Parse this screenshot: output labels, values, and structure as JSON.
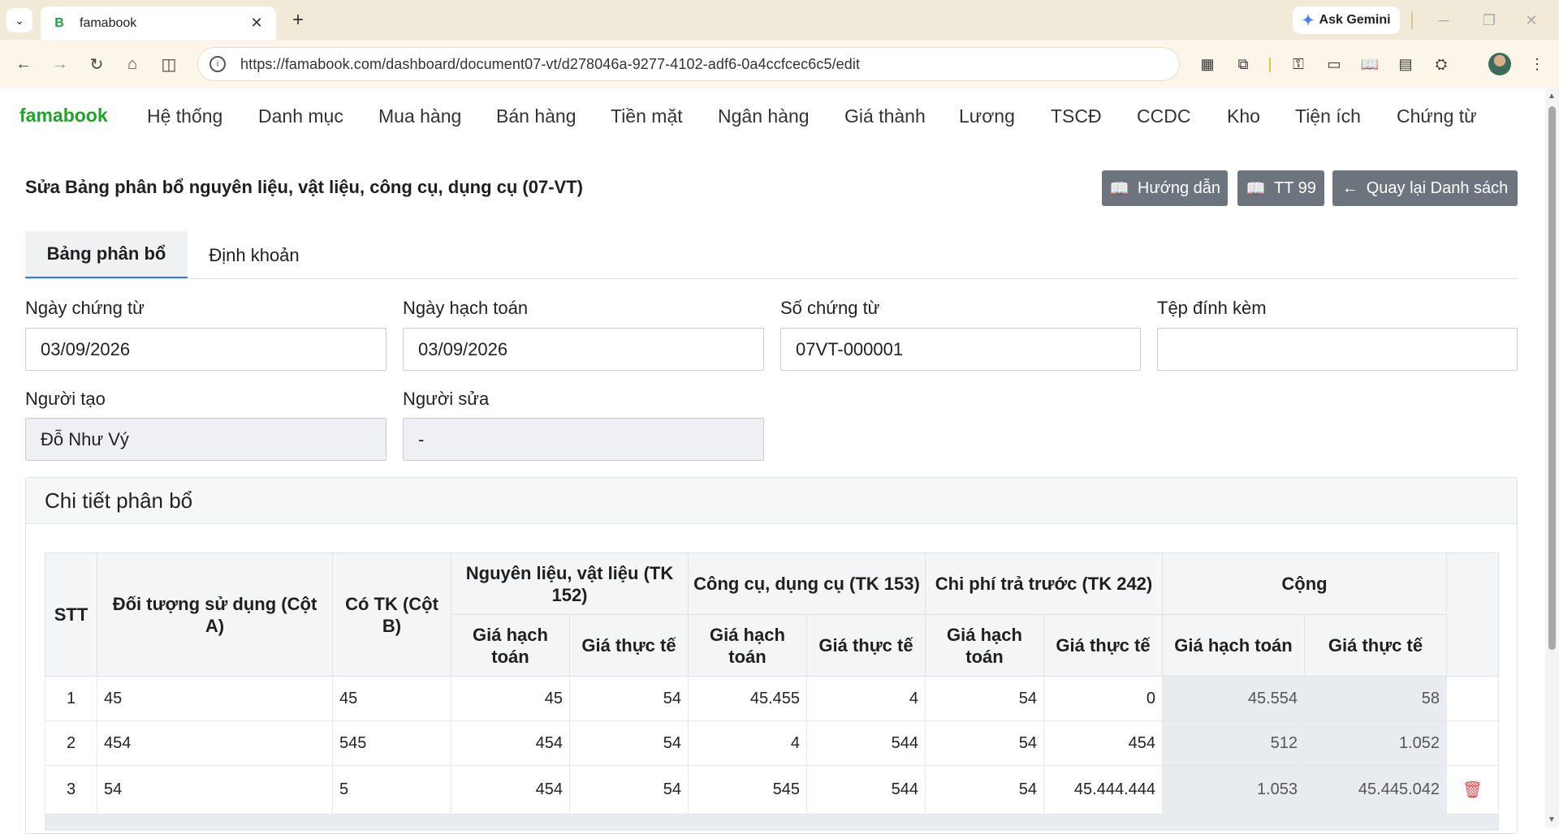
{
  "browser": {
    "tab_title": "famabook",
    "tab_favicon": "B",
    "ask_gemini": "Ask Gemini",
    "url": "https://famabook.com/dashboard/document07-vt/d278046a-9277-4102-adf6-0a4ccfcec6c5/edit"
  },
  "app": {
    "brand": "famabook",
    "nav": [
      "Hệ thống",
      "Danh mục",
      "Mua hàng",
      "Bán hàng",
      "Tiền mặt",
      "Ngân hàng",
      "Giá thành",
      "Lương",
      "TSCĐ",
      "CCDC",
      "Kho",
      "Tiện ích",
      "Chứng từ"
    ]
  },
  "page": {
    "title": "Sửa Bảng phân bổ nguyên liệu, vật liệu, công cụ, dụng cụ (07-VT)",
    "buttons": {
      "guide": "Hướng dẫn",
      "tt99": "TT 99",
      "back": "Quay lại Danh sách"
    },
    "tabs": [
      "Bảng phân bổ",
      "Định khoản"
    ]
  },
  "form": {
    "doc_date_label": "Ngày chứng từ",
    "doc_date": "03/09/2026",
    "post_date_label": "Ngày hạch toán",
    "post_date": "03/09/2026",
    "doc_no_label": "Số chứng từ",
    "doc_no": "07VT-000001",
    "attach_label": "Tệp đính kèm",
    "attach": "",
    "creator_label": "Người tạo",
    "creator": "Đỗ Như Vý",
    "editor_label": "Người sửa",
    "editor": "-"
  },
  "detail": {
    "title": "Chi tiết phân bổ",
    "headers": {
      "stt": "STT",
      "object": "Đối tượng sử dụng (Cột A)",
      "credit": "Có TK (Cột B)",
      "g152": "Nguyên liệu, vật liệu (TK 152)",
      "g153": "Công cụ, dụng cụ (TK 153)",
      "g242": "Chi phí trả trước (TK 242)",
      "total": "Cộng",
      "planned": "Giá hạch toán",
      "actual": "Giá thực tế"
    },
    "rows": [
      {
        "stt": "1",
        "object": "45",
        "credit": "45",
        "p152": "45",
        "a152": "54",
        "p153": "45.455",
        "a153": "4",
        "p242": "54",
        "a242": "0",
        "ptotal": "45.554",
        "atotal": "58"
      },
      {
        "stt": "2",
        "object": "454",
        "credit": "545",
        "p152": "454",
        "a152": "54",
        "p153": "4",
        "a153": "544",
        "p242": "54",
        "a242": "454",
        "ptotal": "512",
        "atotal": "1.052"
      },
      {
        "stt": "3",
        "object": "54",
        "credit": "5",
        "p152": "454",
        "a152": "54",
        "p153": "545",
        "a153": "544",
        "p242": "54",
        "a242": "45.444.444",
        "ptotal": "1.053",
        "atotal": "45.445.042"
      }
    ]
  }
}
